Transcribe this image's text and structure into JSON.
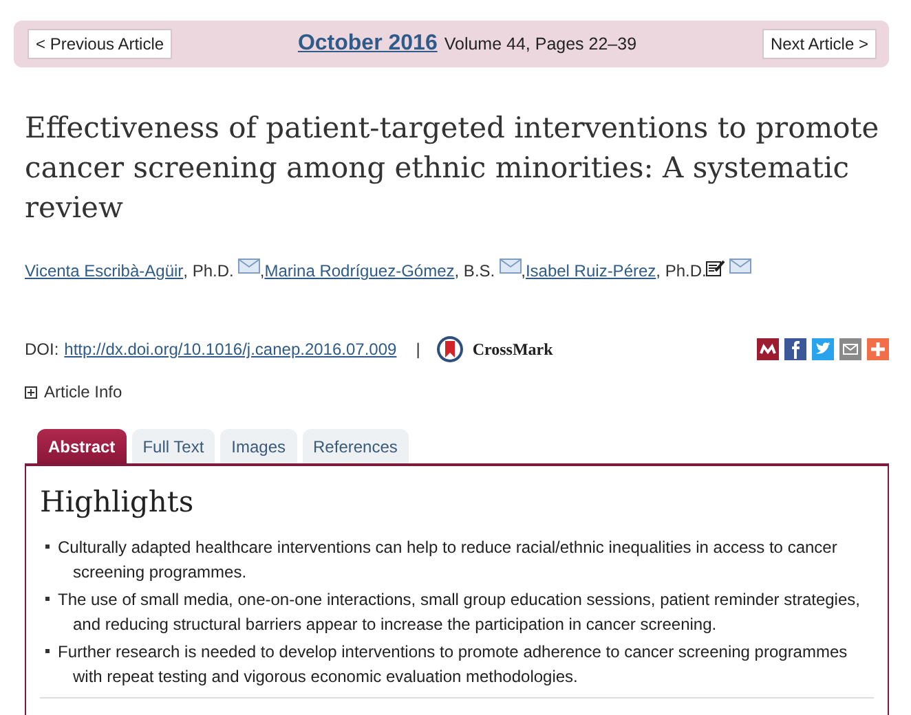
{
  "nav": {
    "previous": "< Previous Article",
    "issue_link": "October 2016",
    "issue_details": "Volume 44, Pages 22–39",
    "next": "Next Article >"
  },
  "title": "Effectiveness of patient-targeted interventions to promote cancer screening among ethnic minorities: A systematic review",
  "authors": [
    {
      "name": "Vicenta Escribà-Agüir",
      "degree": ", Ph.D.",
      "corresponding": false,
      "separator": ","
    },
    {
      "name": "Marina Rodríguez-Gómez",
      "degree": ", B.S.",
      "corresponding": false,
      "separator": ","
    },
    {
      "name": "Isabel Ruiz-Pérez",
      "degree": ", Ph.D.",
      "corresponding": true
    }
  ],
  "doi": {
    "label": "DOI:",
    "link": "http://dx.doi.org/10.1016/j.canep.2016.07.009",
    "divider": "|",
    "crossmark": "CrossMark"
  },
  "article_info": {
    "label": "Article Info",
    "expanded": false
  },
  "tabs": [
    {
      "label": "Abstract",
      "selected": true
    },
    {
      "label": "Full Text",
      "selected": false
    },
    {
      "label": "Images",
      "selected": false
    },
    {
      "label": "References",
      "selected": false
    }
  ],
  "highlights": {
    "heading": "Highlights",
    "items": [
      "Culturally adapted healthcare interventions can help to reduce racial/ethnic inequalities in access to cancer screening programmes.",
      "The use of small media, one-on-one interactions, small group education sessions, patient reminder strategies, and reducing structural barriers appear to increase the participation in cancer screening.",
      "Further research is needed to develop interventions to promote adherence to cancer screening programmes with repeat testing and vigorous economic evaluation methodologies."
    ]
  }
}
